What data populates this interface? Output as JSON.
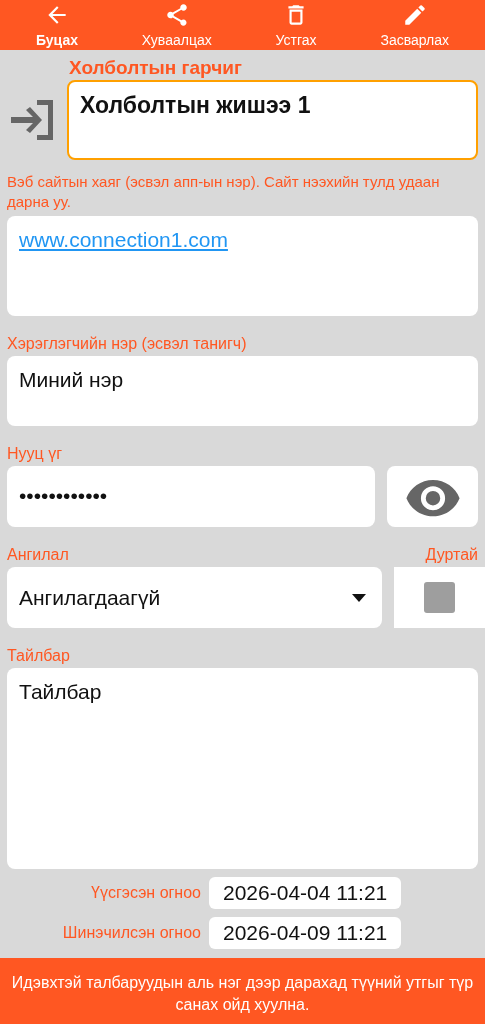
{
  "toolbar": [
    {
      "label": "Буцах",
      "kind": "back",
      "selected": true
    },
    {
      "label": "Хуваалцах",
      "kind": "share",
      "selected": false
    },
    {
      "label": "Устгах",
      "kind": "delete",
      "selected": false
    },
    {
      "label": "Засварлах",
      "kind": "edit",
      "selected": false
    }
  ],
  "title_field": {
    "label": "Холболтын гарчиг",
    "value": "Холболтын жишээ 1",
    "focused": true
  },
  "url_field": {
    "label": "Вэб сайтын хаяг (эсвэл апп-ын нэр). Сайт нээхийн тулд удаан дарна уу.",
    "value": "www.connection1.com"
  },
  "username_field": {
    "label": "Хэрэглэгчийн нэр (эсвэл танигч)",
    "value": "Миний нэр"
  },
  "password_field": {
    "label": "Нууц үг",
    "value": "••••••••••••"
  },
  "category": {
    "label": "Ангилал",
    "value": "Ангилагдаагүй"
  },
  "favorite": {
    "label": "Дуртай",
    "checked": false
  },
  "description": {
    "label": "Тайлбар",
    "value": "Тайлбар"
  },
  "dates": [
    {
      "label": "Үүсгэсэн огноо",
      "value": "2026-04-04 11:21"
    },
    {
      "label": "Шинэчилсэн огноо",
      "value": "2026-04-09 11:21"
    }
  ],
  "footer": "Идэвхтэй талбаруудын аль нэг дээр дарахад түүний утгыг түр санах ойд хуулна."
}
